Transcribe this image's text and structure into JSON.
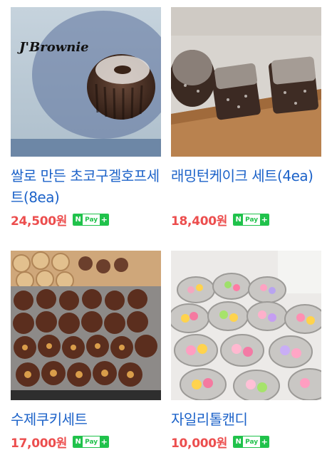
{
  "products": [
    {
      "title": "쌀로 만든 초코구겔호프세트(8ea)",
      "price": "24,500원",
      "image_label": "J'Brownie",
      "npay": {
        "n": "N",
        "pay": "Pay",
        "plus": "+"
      }
    },
    {
      "title": "래밍턴케이크 세트(4ea)",
      "price": "18,400원",
      "npay": {
        "n": "N",
        "pay": "Pay",
        "plus": "+"
      }
    },
    {
      "title": "수제쿠키세트",
      "price": "17,000원",
      "npay": {
        "n": "N",
        "pay": "Pay",
        "plus": "+"
      }
    },
    {
      "title": "자일리톨캔디",
      "price": "10,000원",
      "npay": {
        "n": "N",
        "pay": "Pay",
        "plus": "+"
      }
    }
  ],
  "colors": {
    "title": "#1d63c9",
    "price": "#ec4e4e",
    "npay_green": "#20c24b"
  }
}
